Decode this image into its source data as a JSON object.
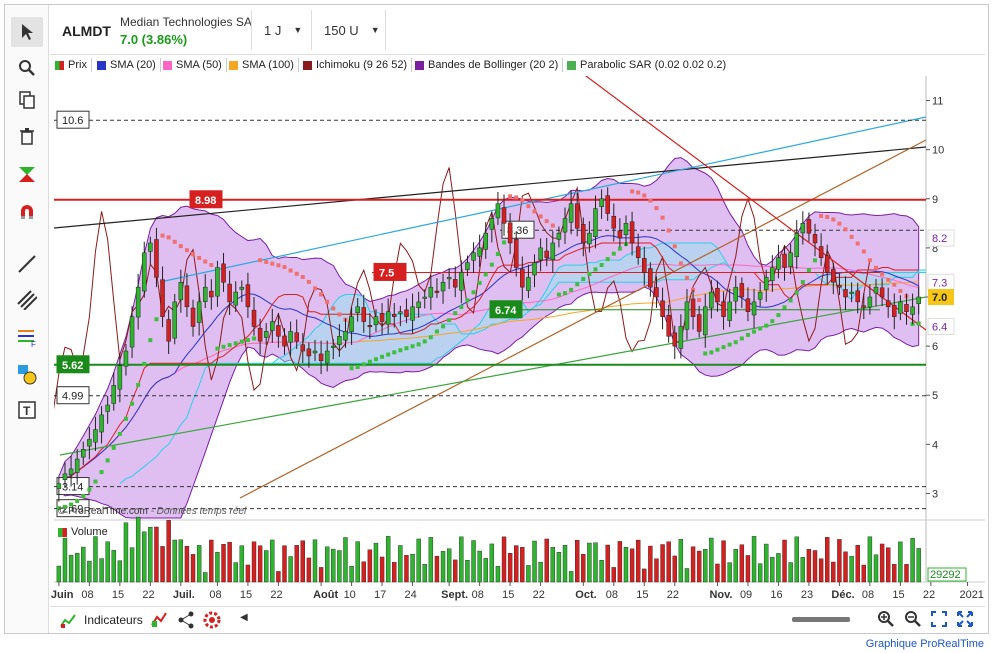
{
  "header": {
    "ticker": "ALMDT",
    "company": "Median Technologies SA",
    "price": "7.0 (3.86%)",
    "interval": "1 J",
    "units": "150 U"
  },
  "legend": [
    {
      "label": "Prix",
      "color": "#d73027"
    },
    {
      "label": "SMA (20)",
      "color": "#2a35c8"
    },
    {
      "label": "SMA (50)",
      "color": "#ff66c4"
    },
    {
      "label": "SMA (100)",
      "color": "#f5a623"
    },
    {
      "label": "Ichimoku (9 26 52)",
      "color": "#7a1fa2"
    },
    {
      "label": "Bandes de Bollinger (20 2)",
      "color": "#7a1fa2"
    },
    {
      "label": "Parabolic SAR (0.02 0.02 0.2)",
      "color": "#4caf50"
    }
  ],
  "watermark": "© ProRealTime.com",
  "watermark_note": "- Données temps réel",
  "volume_label": "Volume",
  "volume_value": "29292",
  "indicators_label": "Indicateurs",
  "footer": "Graphique ProRealTime",
  "colors": {
    "up": "#2db52d",
    "down": "#d62020",
    "sar": "#3dbf3d",
    "sar_down": "#f07070",
    "bb_fill": "#c58be6",
    "cloud": "#8ee6f0"
  },
  "chart_data": {
    "type": "candlestick",
    "ylim": [
      2.5,
      11.5
    ],
    "y_ticks": [
      3,
      4,
      5,
      6,
      7,
      8,
      9,
      10,
      11
    ],
    "x_ticks": [
      {
        "label": "Juin",
        "bar": 0
      },
      {
        "label": "08",
        "bar": 5
      },
      {
        "label": "15",
        "bar": 10
      },
      {
        "label": "22",
        "bar": 15
      },
      {
        "label": "Juil.",
        "bar": 20
      },
      {
        "label": "08",
        "bar": 26
      },
      {
        "label": "15",
        "bar": 31
      },
      {
        "label": "22",
        "bar": 36
      },
      {
        "label": "Août",
        "bar": 43
      },
      {
        "label": "10",
        "bar": 48
      },
      {
        "label": "17",
        "bar": 53
      },
      {
        "label": "24",
        "bar": 58
      },
      {
        "label": "Sept.",
        "bar": 64
      },
      {
        "label": "08",
        "bar": 69
      },
      {
        "label": "15",
        "bar": 74
      },
      {
        "label": "22",
        "bar": 79
      },
      {
        "label": "Oct.",
        "bar": 86
      },
      {
        "label": "08",
        "bar": 91
      },
      {
        "label": "15",
        "bar": 96
      },
      {
        "label": "22",
        "bar": 101
      },
      {
        "label": "Nov.",
        "bar": 108
      },
      {
        "label": "09",
        "bar": 113
      },
      {
        "label": "16",
        "bar": 118
      },
      {
        "label": "23",
        "bar": 123
      },
      {
        "label": "Déc.",
        "bar": 128
      },
      {
        "label": "08",
        "bar": 133
      },
      {
        "label": "15",
        "bar": 138
      },
      {
        "label": "22",
        "bar": 143
      },
      {
        "label": "2021",
        "bar": 149
      }
    ],
    "horizontal_levels": [
      {
        "value": 10.6,
        "label": "10.6",
        "style": "dashed"
      },
      {
        "value": 8.98,
        "label": "8.98",
        "style": "red"
      },
      {
        "value": 8.36,
        "label": "8.36",
        "style": "dashed"
      },
      {
        "value": 7.5,
        "label": "7.5",
        "style": "red-partial"
      },
      {
        "value": 6.74,
        "label": "6.74",
        "style": "green-partial"
      },
      {
        "value": 5.62,
        "label": "5.62",
        "style": "green"
      },
      {
        "value": 4.99,
        "label": "4.99",
        "style": "dashed"
      },
      {
        "value": 3.14,
        "label": "3.14",
        "style": "dashed"
      },
      {
        "value": 2.69,
        "label": "2.69",
        "style": "dashed"
      }
    ],
    "right_labels": [
      {
        "value": 8.2,
        "label": "8.2",
        "color": "#7a1fa2"
      },
      {
        "value": 7.3,
        "label": "7.3",
        "color": "#7a1fa2"
      },
      {
        "value": 7.0,
        "label": "7.0",
        "color": "#f5c518"
      },
      {
        "value": 6.4,
        "label": "6.4",
        "color": "#7a1fa2"
      }
    ],
    "close": [
      3.2,
      3.4,
      3.5,
      3.7,
      3.9,
      4.1,
      4.3,
      4.6,
      4.8,
      5.2,
      5.6,
      5.9,
      6.6,
      7.2,
      7.9,
      8.1,
      7.4,
      6.6,
      6.1,
      6.9,
      7.3,
      6.8,
      6.4,
      6.9,
      7.2,
      7.0,
      7.6,
      7.3,
      6.9,
      7.1,
      7.2,
      6.8,
      6.4,
      6.1,
      6.3,
      6.5,
      6.2,
      6.0,
      6.3,
      6.1,
      5.9,
      5.8,
      5.9,
      5.7,
      5.9,
      6.0,
      6.2,
      6.3,
      6.6,
      6.8,
      6.5,
      6.4,
      6.6,
      6.5,
      6.7,
      6.6,
      6.7,
      6.6,
      6.8,
      6.9,
      7.0,
      7.2,
      7.1,
      7.3,
      7.4,
      7.2,
      7.5,
      7.7,
      7.9,
      8.0,
      8.3,
      8.6,
      8.9,
      8.5,
      8.1,
      7.6,
      7.2,
      7.4,
      7.7,
      8.0,
      7.8,
      8.1,
      8.3,
      8.6,
      8.9,
      8.4,
      8.1,
      8.3,
      8.8,
      9.0,
      8.7,
      8.4,
      8.2,
      8.5,
      8.1,
      7.8,
      7.5,
      7.2,
      7.0,
      6.6,
      6.2,
      6.0,
      6.4,
      6.9,
      6.6,
      6.3,
      6.8,
      7.1,
      6.9,
      6.6,
      6.9,
      7.2,
      7.0,
      6.7,
      6.9,
      7.1,
      7.4,
      7.6,
      7.8,
      7.6,
      7.9,
      8.3,
      8.5,
      8.3,
      8.1,
      7.8,
      7.5,
      7.3,
      7.2,
      7.0,
      7.1,
      6.9,
      6.8,
      7.0,
      7.2,
      7.0,
      6.8,
      6.6,
      6.9,
      6.7,
      6.8,
      7.0
    ]
  }
}
